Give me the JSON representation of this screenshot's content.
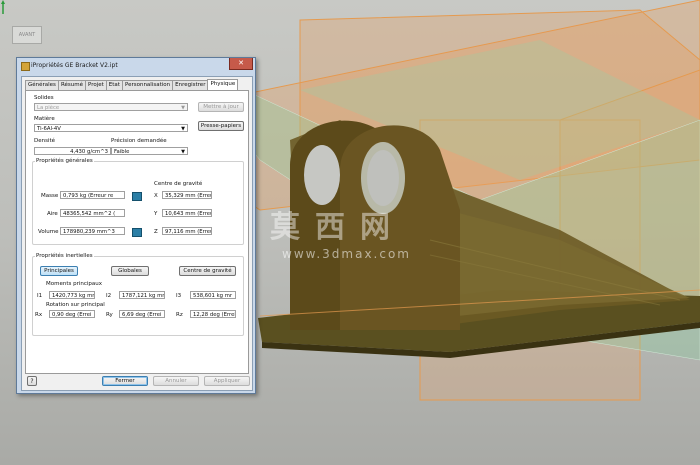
{
  "viewport": {
    "viewcube_label": "AVANT",
    "watermark_text": "莫西网",
    "watermark_url": "www.3dmax.com",
    "colors": {
      "background": "#c0c1bd",
      "plane_orange": "#e8a060",
      "plane_green": "#8fd0a0",
      "part": "#5a4a1e"
    }
  },
  "dialog": {
    "title": "iPropriétés GE Bracket V2.ipt",
    "close_label": "✕",
    "tabs": [
      {
        "label": "Générales"
      },
      {
        "label": "Résumé"
      },
      {
        "label": "Projet"
      },
      {
        "label": "Etat"
      },
      {
        "label": "Personnalisation"
      },
      {
        "label": "Enregistrer"
      },
      {
        "label": "Physique"
      }
    ],
    "active_tab": "Physique",
    "solids": {
      "label": "Solides",
      "value": "La pièce",
      "update_button": "Mettre à jour"
    },
    "material": {
      "label": "Matière",
      "value": "Ti-6Al-4V",
      "clipboard_button": "Presse-papiers"
    },
    "density": {
      "label": "Densité",
      "value": "4,430 g/cm^3"
    },
    "precision": {
      "label": "Précision demandée",
      "value": "Faible"
    },
    "general_properties": {
      "title": "Propriétés générales",
      "cog_title": "Centre de gravité",
      "rows": [
        {
          "label": "Masse",
          "value": "0,793 kg (Erreur re",
          "axis": "X",
          "cog": "35,329 mm (Erreur"
        },
        {
          "label": "Aire",
          "value": "48365,542 mm^2 (",
          "axis": "Y",
          "cog": "10,643 mm (Erreur"
        },
        {
          "label": "Volume",
          "value": "178980,239 mm^3",
          "axis": "Z",
          "cog": "97,116 mm (Erreur"
        }
      ]
    },
    "inertial_properties": {
      "title": "Propriétés inertielles",
      "buttons": {
        "principal": "Principales",
        "global": "Globales",
        "cog": "Centre de gravité"
      },
      "moments_title": "Moments principaux",
      "moments": [
        {
          "label": "I1",
          "value": "1420,773 kg mr"
        },
        {
          "label": "I2",
          "value": "1787,121 kg mr"
        },
        {
          "label": "I3",
          "value": "538,601 kg mr"
        }
      ],
      "rotation_title": "Rotation sur principal",
      "rotations": [
        {
          "label": "Rx",
          "value": "0,90 deg (Errei"
        },
        {
          "label": "Ry",
          "value": "6,69 deg (Errei"
        },
        {
          "label": "Rz",
          "value": "12,28 deg (Errei"
        }
      ]
    },
    "footer": {
      "help": "?",
      "close": "Fermer",
      "cancel": "Annuler",
      "apply": "Appliquer"
    }
  }
}
